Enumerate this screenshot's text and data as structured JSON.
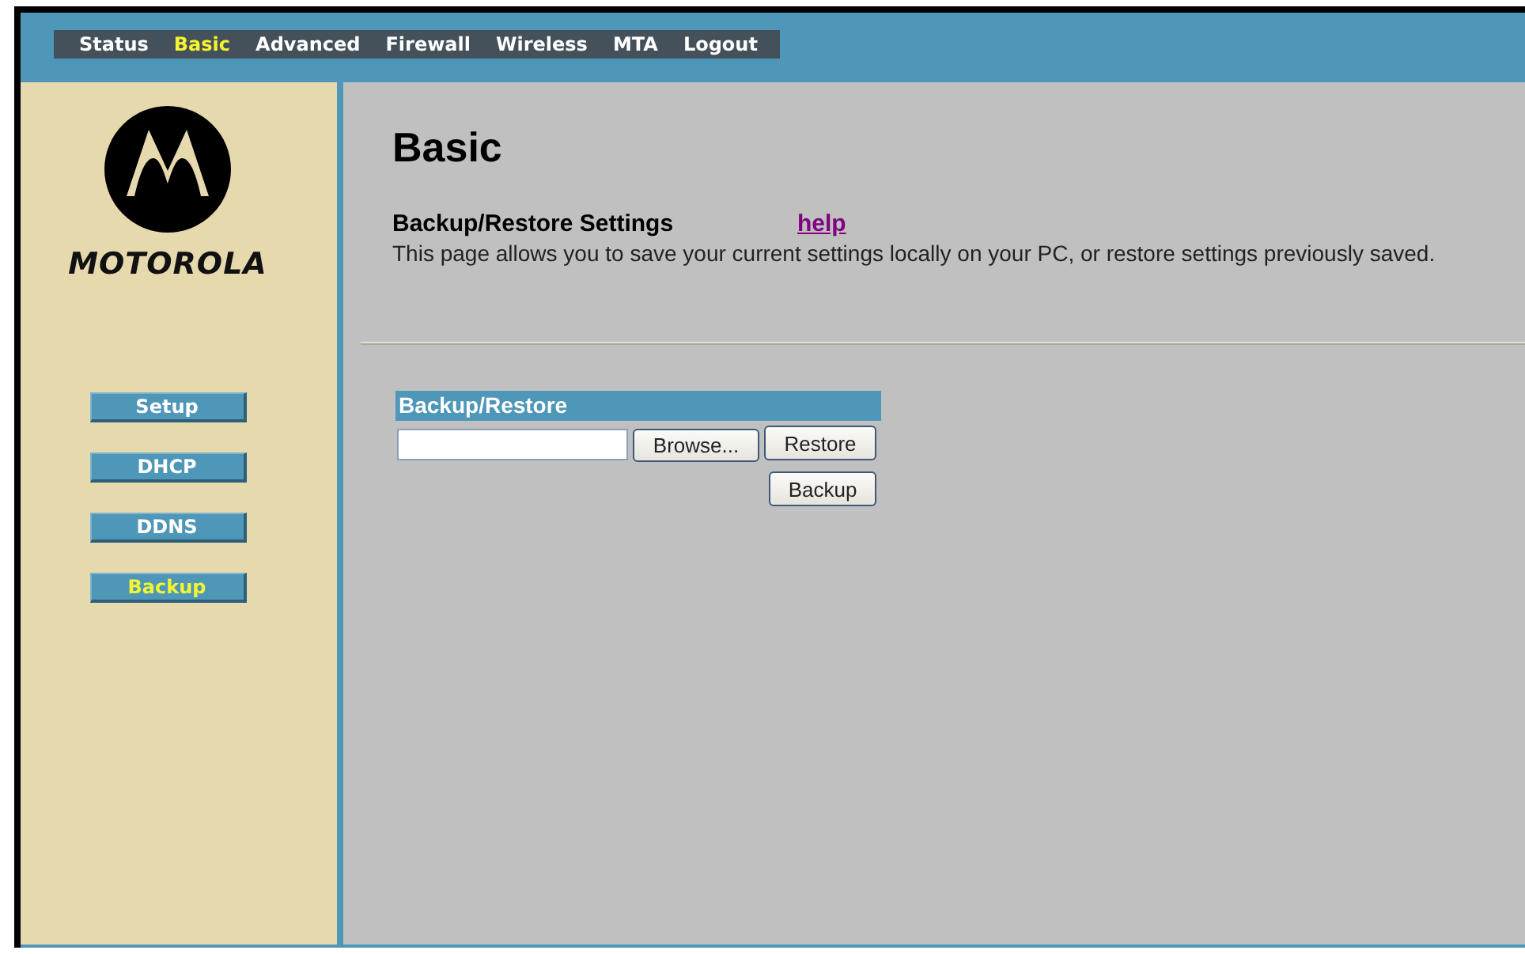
{
  "nav": [
    {
      "label": "Status",
      "selected": false
    },
    {
      "label": "Basic",
      "selected": true
    },
    {
      "label": "Advanced",
      "selected": false
    },
    {
      "label": "Firewall",
      "selected": false
    },
    {
      "label": "Wireless",
      "selected": false
    },
    {
      "label": "MTA",
      "selected": false
    },
    {
      "label": "Logout",
      "selected": false
    }
  ],
  "sidebar": {
    "brand": "MOTOROLA",
    "items": [
      {
        "label": "Setup",
        "selected": false
      },
      {
        "label": "DHCP",
        "selected": false
      },
      {
        "label": "DDNS",
        "selected": false
      },
      {
        "label": "Backup",
        "selected": true
      }
    ]
  },
  "content": {
    "title": "Basic",
    "section_title": "Backup/Restore Settings",
    "help_link": "help",
    "description": "This page allows you to save your current settings locally on your PC, or restore settings previously saved.",
    "panel": {
      "title": "Backup/Restore",
      "browse_button": "Browse...",
      "restore_button": "Restore",
      "backup_button": "Backup"
    }
  }
}
